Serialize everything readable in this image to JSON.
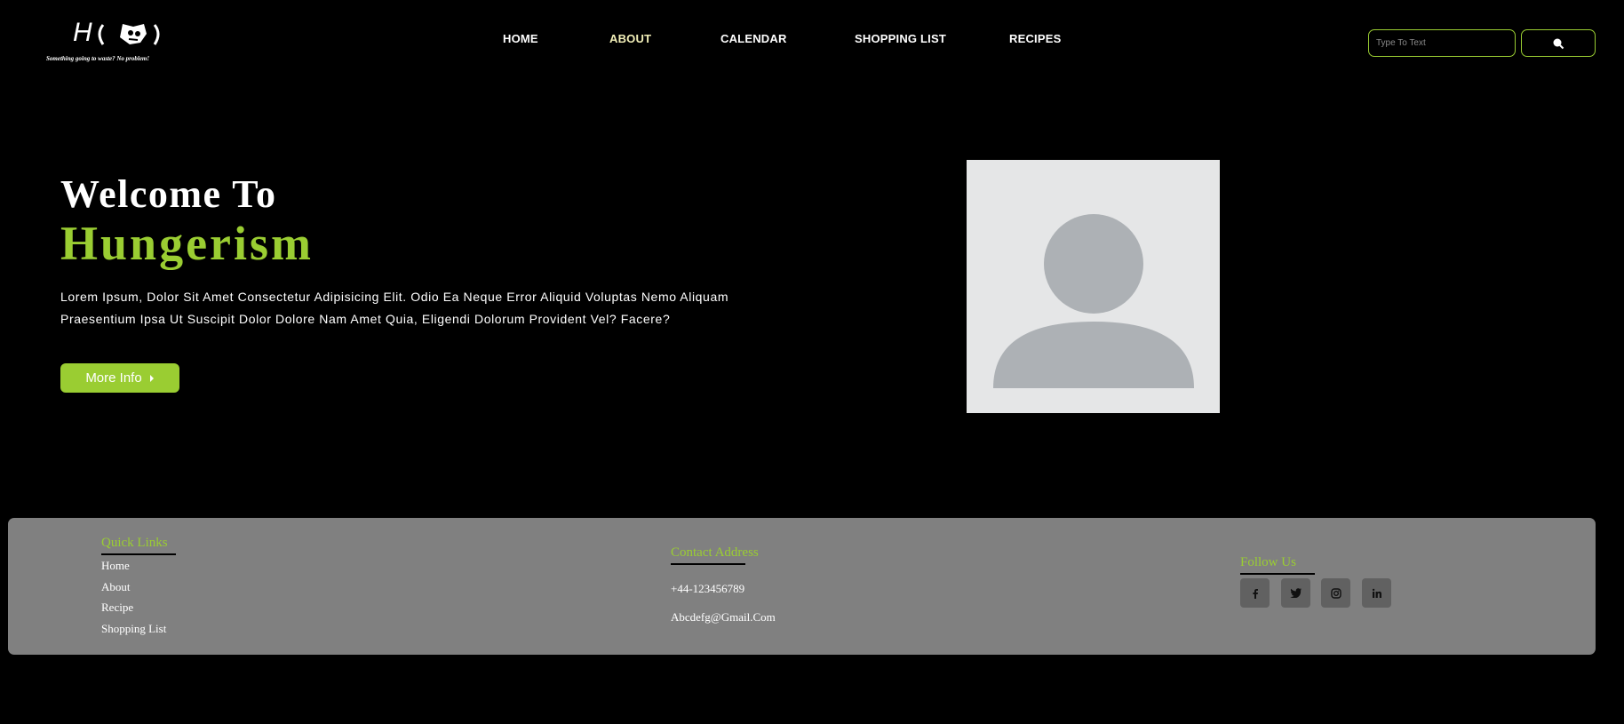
{
  "header": {
    "logo_text": "H",
    "tagline": "Something going to waste? No problem!",
    "nav": [
      {
        "label": "HOME"
      },
      {
        "label": "ABOUT"
      },
      {
        "label": "CALENDAR"
      },
      {
        "label": "SHOPPING LIST"
      },
      {
        "label": "RECIPES"
      }
    ],
    "search": {
      "placeholder": "Type To Text",
      "value": ""
    }
  },
  "hero": {
    "welcome": "Welcome To",
    "brand": "Hungerism",
    "description": "Lorem Ipsum, Dolor Sit Amet Consectetur Adipisicing Elit. Odio Ea Neque Error Aliquid Voluptas Nemo Aliquam Praesentium Ipsa Ut Suscipit Dolor Dolore Nam Amet Quia, Eligendi Dolorum Provident Vel? Facere?",
    "button_label": "More Info"
  },
  "footer": {
    "quick_links": {
      "title": "Quick Links",
      "items": [
        "Home",
        "About",
        "Recipe",
        "Shopping List"
      ]
    },
    "contact": {
      "title": "Contact Address",
      "phone": "+44-123456789",
      "email": "Abcdefg@Gmail.Com"
    },
    "follow": {
      "title": "Follow Us",
      "icons": [
        "facebook-icon",
        "twitter-icon",
        "instagram-icon",
        "linkedin-icon"
      ]
    }
  },
  "colors": {
    "accent": "#9acd32",
    "background": "#000000",
    "footer_bg": "#808080",
    "social_bg": "#616161",
    "active_nav": "#f2efb8"
  }
}
